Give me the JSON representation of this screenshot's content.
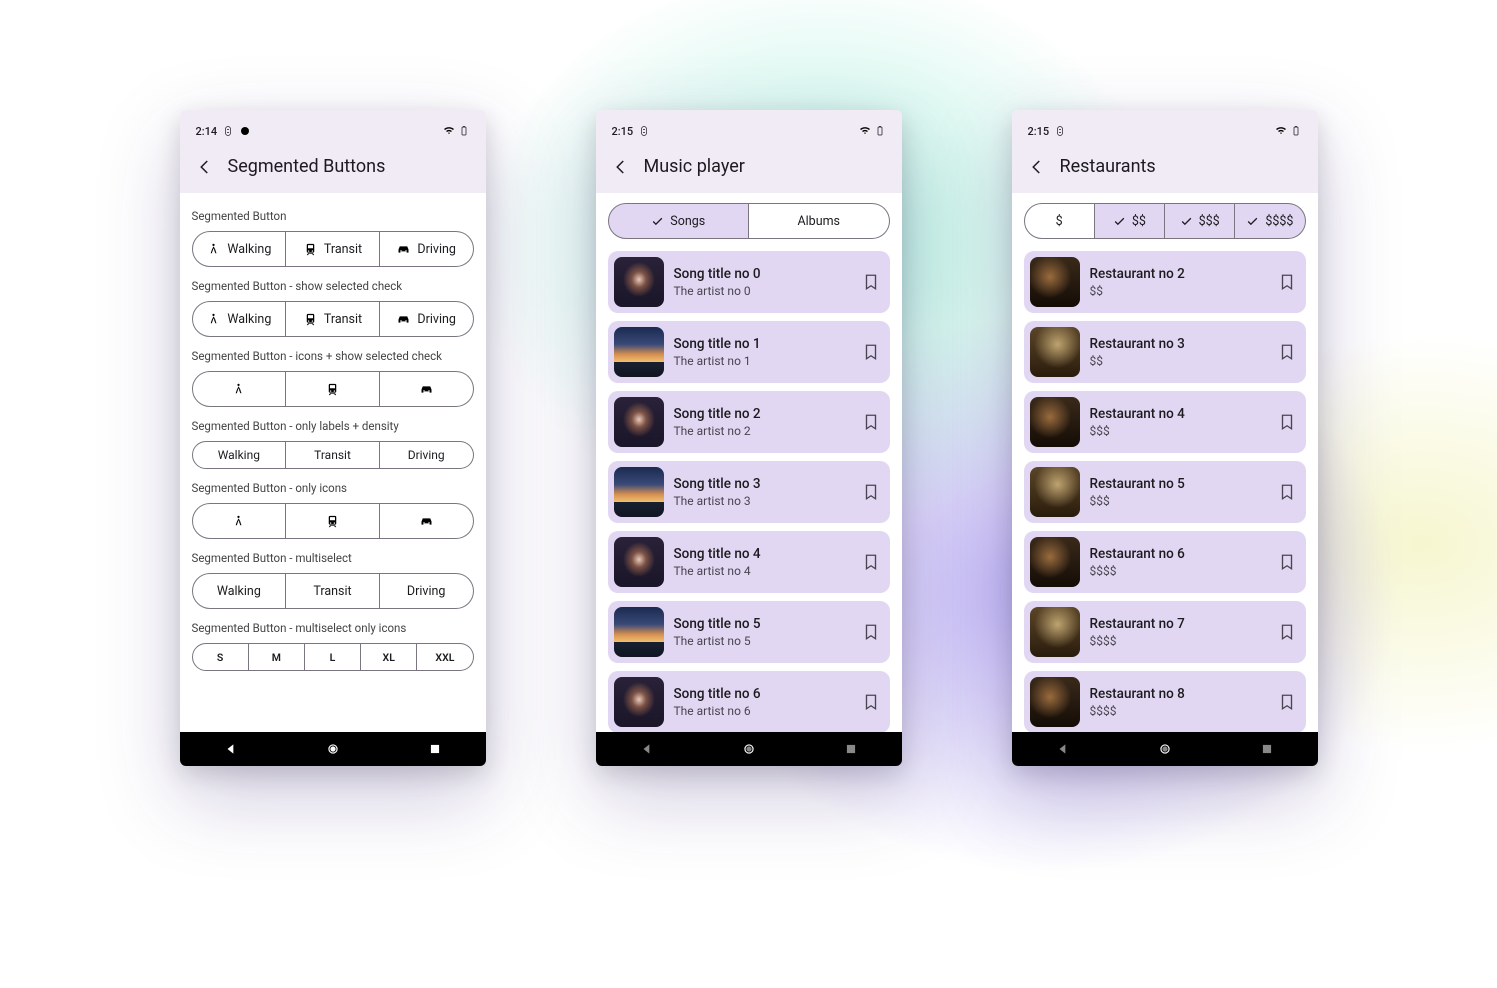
{
  "phones": {
    "segmented": {
      "status_time": "2:14",
      "title": "Segmented Buttons",
      "sections": [
        {
          "label": "Segmented Button",
          "items": [
            "Walking",
            "Transit",
            "Driving"
          ]
        },
        {
          "label": "Segmented Button - show selected check",
          "items": [
            "Walking",
            "Transit",
            "Driving"
          ]
        },
        {
          "label": "Segmented Button - icons + show selected check"
        },
        {
          "label": "Segmented Button - only labels + density",
          "items": [
            "Walking",
            "Transit",
            "Driving"
          ]
        },
        {
          "label": "Segmented Button - only icons"
        },
        {
          "label": "Segmented Button - multiselect",
          "items": [
            "Walking",
            "Transit",
            "Driving"
          ]
        },
        {
          "label": "Segmented Button - multiselect only icons",
          "items": [
            "S",
            "M",
            "L",
            "XL",
            "XXL"
          ]
        }
      ]
    },
    "music": {
      "status_time": "2:15",
      "title": "Music player",
      "tabs": [
        "Songs",
        "Albums"
      ],
      "songs": [
        {
          "title": "Song title no 0",
          "artist": "The artist no 0"
        },
        {
          "title": "Song title no 1",
          "artist": "The artist no 1"
        },
        {
          "title": "Song title no 2",
          "artist": "The artist no 2"
        },
        {
          "title": "Song title no 3",
          "artist": "The artist no 3"
        },
        {
          "title": "Song title no 4",
          "artist": "The artist no 4"
        },
        {
          "title": "Song title no 5",
          "artist": "The artist no 5"
        },
        {
          "title": "Song title no 6",
          "artist": "The artist no 6"
        }
      ]
    },
    "restaurants": {
      "status_time": "2:15",
      "title": "Restaurants",
      "priceTabs": [
        "$",
        "$$",
        "$$$",
        "$$$$"
      ],
      "items": [
        {
          "name": "Restaurant no 2",
          "price": "$$"
        },
        {
          "name": "Restaurant no 3",
          "price": "$$"
        },
        {
          "name": "Restaurant no 4",
          "price": "$$$"
        },
        {
          "name": "Restaurant no 5",
          "price": "$$$"
        },
        {
          "name": "Restaurant no 6",
          "price": "$$$$"
        },
        {
          "name": "Restaurant no 7",
          "price": "$$$$"
        },
        {
          "name": "Restaurant no 8",
          "price": "$$$$"
        }
      ]
    }
  }
}
